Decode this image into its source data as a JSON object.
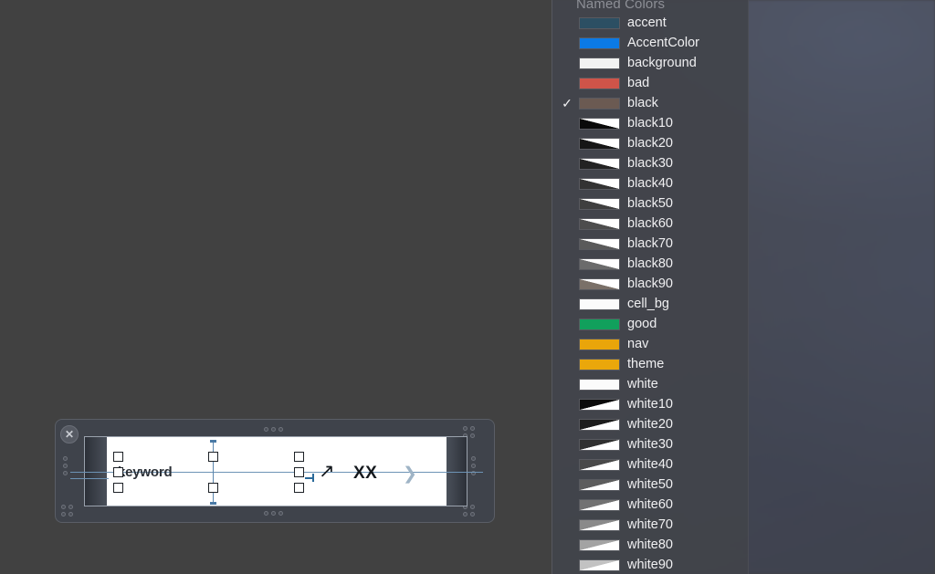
{
  "menu": {
    "title": "Named Colors",
    "checked_item": "black",
    "items": [
      {
        "label": "accent",
        "swatch": "solid",
        "color": "#2c4f63"
      },
      {
        "label": "AccentColor",
        "swatch": "solid",
        "color": "#0b7ae6"
      },
      {
        "label": "background",
        "swatch": "solid",
        "color": "#f2f2f2"
      },
      {
        "label": "bad",
        "swatch": "solid",
        "color": "#cf5449"
      },
      {
        "label": "black",
        "swatch": "solid",
        "color": "#6b5a52"
      },
      {
        "label": "black10",
        "swatch": "diag-black",
        "color": "#0a0a0a"
      },
      {
        "label": "black20",
        "swatch": "diag-black",
        "color": "#161616"
      },
      {
        "label": "black30",
        "swatch": "diag-black",
        "color": "#232323"
      },
      {
        "label": "black40",
        "swatch": "diag-black",
        "color": "#333333"
      },
      {
        "label": "black50",
        "swatch": "diag-black",
        "color": "#3f3f3f"
      },
      {
        "label": "black60",
        "swatch": "diag-black",
        "color": "#4d4d4d"
      },
      {
        "label": "black70",
        "swatch": "diag-black",
        "color": "#5a5a5a"
      },
      {
        "label": "black80",
        "swatch": "diag-black",
        "color": "#6b6b6b"
      },
      {
        "label": "black90",
        "swatch": "diag-black",
        "color": "#7a7068"
      },
      {
        "label": "cell_bg",
        "swatch": "solid",
        "color": "#fbfbfb"
      },
      {
        "label": "good",
        "swatch": "solid",
        "color": "#11a05c"
      },
      {
        "label": "nav",
        "swatch": "solid",
        "color": "#e9a50a"
      },
      {
        "label": "theme",
        "swatch": "solid",
        "color": "#eaa70b"
      },
      {
        "label": "white",
        "swatch": "solid",
        "color": "#fbfbfb"
      },
      {
        "label": "white10",
        "swatch": "diag-white",
        "color": "#0a0a0a"
      },
      {
        "label": "white20",
        "swatch": "diag-white",
        "color": "#1c1c1c"
      },
      {
        "label": "white30",
        "swatch": "diag-white",
        "color": "#303030"
      },
      {
        "label": "white40",
        "swatch": "diag-white",
        "color": "#4a4a4a"
      },
      {
        "label": "white50",
        "swatch": "diag-white",
        "color": "#5d5d5d"
      },
      {
        "label": "white60",
        "swatch": "diag-white",
        "color": "#727272"
      },
      {
        "label": "white70",
        "swatch": "diag-white",
        "color": "#8a8a8a"
      },
      {
        "label": "white80",
        "swatch": "diag-white",
        "color": "#a3a3a3"
      },
      {
        "label": "white90",
        "swatch": "diag-white",
        "color": "#c2c2c2"
      }
    ]
  },
  "slide": {
    "close_label": "✕",
    "keyword_text": "keyword",
    "xx_text": "XX",
    "arrow_glyph": "↗",
    "chevron_glyph": "❯"
  },
  "colors": {
    "canvas_bg": "#414141",
    "menu_bg": "#42444a",
    "menu_text": "#f0f0f2",
    "menu_title_text": "#8d8f96",
    "frame_bg": "#3f434b",
    "guide_blue": "#6d93b5",
    "slide_bg": "#ffffff"
  }
}
